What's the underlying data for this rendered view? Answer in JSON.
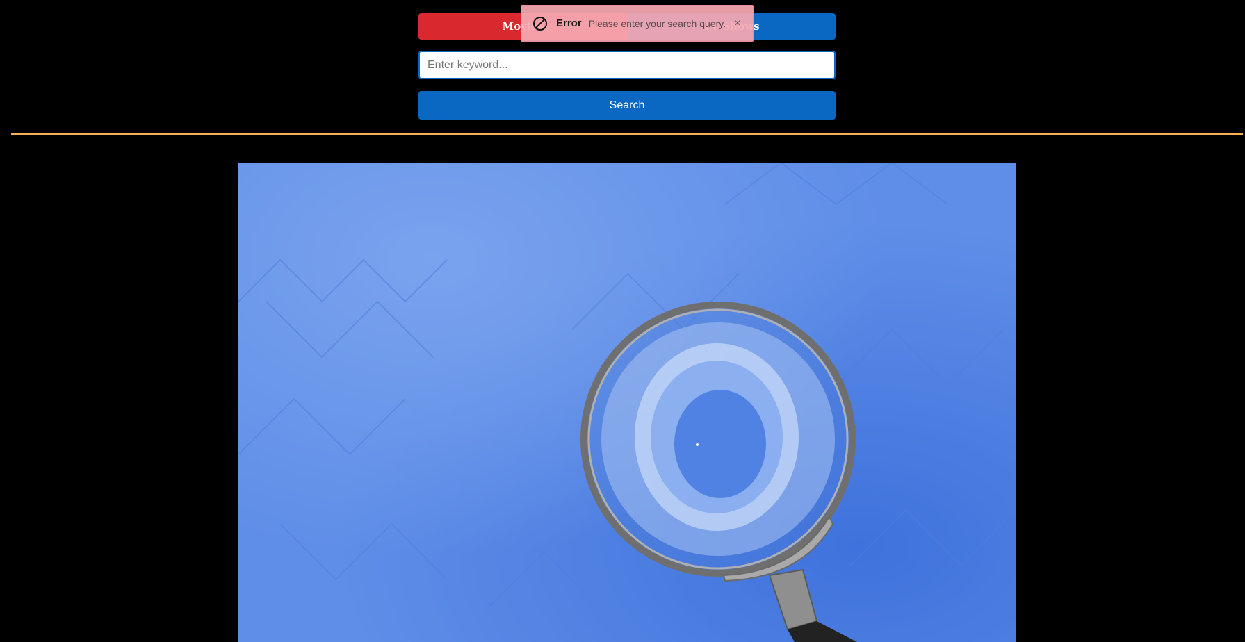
{
  "tabs": [
    {
      "label": "Movies",
      "color": "#d9292f"
    },
    {
      "label": "TV Shows",
      "color": "#0a68c2"
    }
  ],
  "search": {
    "placeholder": "Enter keyword...",
    "value": "",
    "button_label": "Search"
  },
  "divider": {
    "color": "#f4b15a"
  },
  "hero": {
    "image": "magnifying-glass-on-blue-background"
  },
  "toast": {
    "icon": "error-icon",
    "title": "Error",
    "message": "Please enter your search query.",
    "close_label": "×"
  },
  "colors": {
    "background": "#000000",
    "primary": "#0a68c2",
    "danger": "#d9292f",
    "accent": "#f4b15a"
  }
}
